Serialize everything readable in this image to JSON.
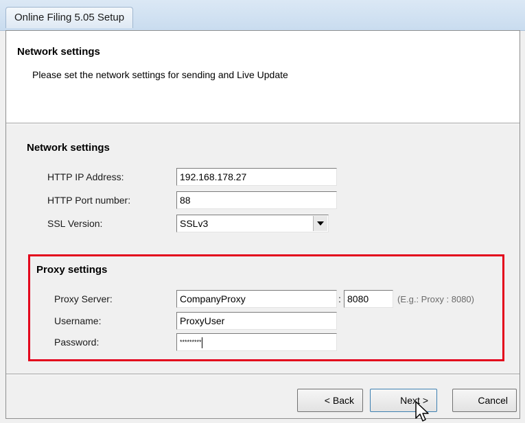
{
  "window": {
    "title": "Online Filing 5.05 Setup"
  },
  "header": {
    "title": "Network settings",
    "subtitle": "Please set the network settings for sending and Live Update"
  },
  "network": {
    "group_title": "Network settings",
    "http_ip_label": "HTTP IP Address:",
    "http_ip_value": "192.168.178.27",
    "http_port_label": "HTTP Port number:",
    "http_port_value": "88",
    "ssl_label": "SSL Version:",
    "ssl_value": "SSLv3"
  },
  "proxy": {
    "group_title": "Proxy settings",
    "server_label": "Proxy Server:",
    "server_value": "CompanyProxy",
    "separator": ":",
    "port_value": "8080",
    "example": "(E.g.: Proxy : 8080)",
    "username_label": "Username:",
    "username_value": "ProxyUser",
    "password_label": "Password:",
    "password_value": "*********"
  },
  "buttons": {
    "back": "< Back",
    "next": "Next >",
    "cancel": "Cancel"
  },
  "colors": {
    "highlight": "#e3001b"
  }
}
